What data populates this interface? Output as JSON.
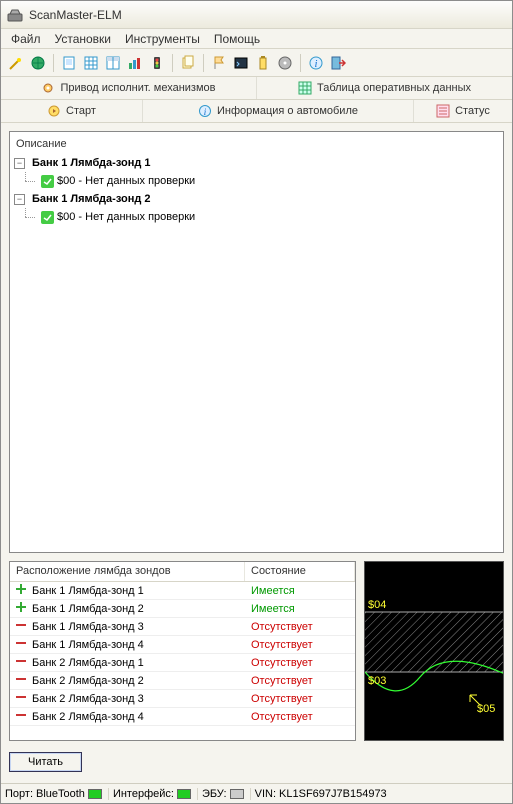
{
  "window": {
    "title": "ScanMaster-ELM"
  },
  "menu": [
    "Файл",
    "Установки",
    "Инструменты",
    "Помощь"
  ],
  "tabs": {
    "row1": [
      {
        "label": "Привод исполнит. механизмов",
        "icon": "gear-icon"
      },
      {
        "label": "Таблица оперативных данных",
        "icon": "table-icon"
      }
    ],
    "row2": [
      {
        "label": "Старт",
        "icon": "start-icon"
      },
      {
        "label": "Информация о автомобиле",
        "icon": "info-icon"
      },
      {
        "label": "Статус",
        "icon": "status-icon"
      }
    ]
  },
  "tree": {
    "title": "Описание",
    "nodes": [
      {
        "label": "Банк 1 Лямбда-зонд 1",
        "child": "$00 - Нет данных проверки"
      },
      {
        "label": "Банк 1 Лямбда-зонд 2",
        "child": "$00 - Нет данных проверки"
      }
    ]
  },
  "grid": {
    "headers": {
      "location": "Расположение лямбда зондов",
      "state": "Состояние"
    },
    "states": {
      "present": "Имеется",
      "absent": "Отсутствует"
    },
    "rows": [
      {
        "label": "Банк 1 Лямбда-зонд 1",
        "present": true
      },
      {
        "label": "Банк 1 Лямбда-зонд 2",
        "present": true
      },
      {
        "label": "Банк 1 Лямбда-зонд 3",
        "present": false
      },
      {
        "label": "Банк 1 Лямбда-зонд 4",
        "present": false
      },
      {
        "label": "Банк 2 Лямбда-зонд 1",
        "present": false
      },
      {
        "label": "Банк 2 Лямбда-зонд 2",
        "present": false
      },
      {
        "label": "Банк 2 Лямбда-зонд 3",
        "present": false
      },
      {
        "label": "Банк 2 Лямбда-зонд 4",
        "present": false
      }
    ]
  },
  "buttons": {
    "read": "Читать"
  },
  "status": {
    "port_label": "Порт:",
    "port_value": "BlueTooth",
    "iface_label": "Интерфейс:",
    "ecu_label": "ЭБУ:",
    "vin_label": "VIN:",
    "vin_value": "KL1SF697J7B154973"
  },
  "chart_data": {
    "type": "line",
    "labels": [
      "$03",
      "$04",
      "$05"
    ],
    "note": "oscilloscope-style waveform preview"
  }
}
